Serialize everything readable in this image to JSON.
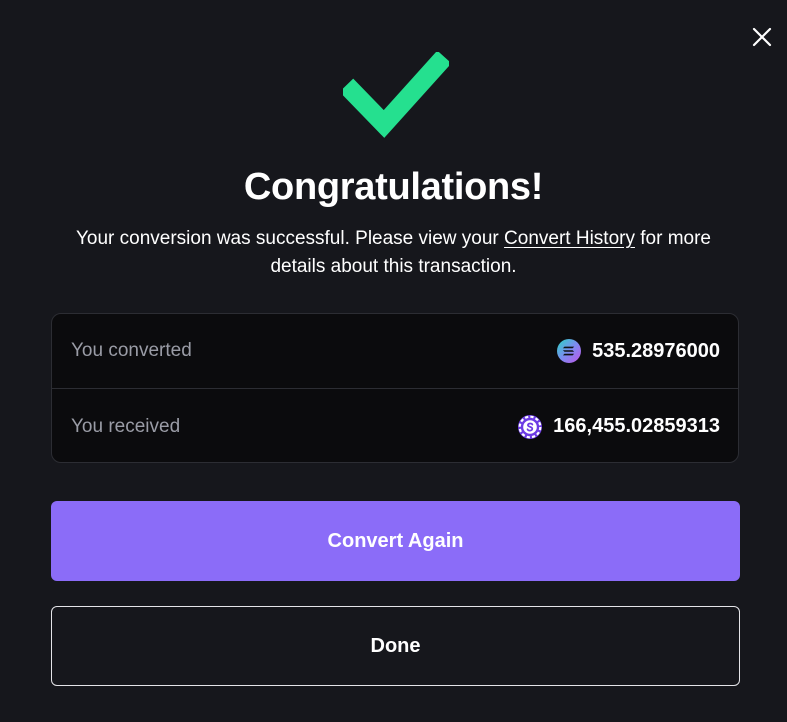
{
  "dialog": {
    "title": "Congratulations!",
    "message_before_link": "Your conversion was successful. Please view your ",
    "link_text": "Convert History",
    "message_after_link": " for more details about this transaction.",
    "close_icon": "close-icon",
    "success_icon": "checkmark-icon"
  },
  "summary": {
    "converted": {
      "label": "You converted",
      "amount": "535.28976000",
      "token_icon": "solana-token-icon"
    },
    "received": {
      "label": "You received",
      "amount": "166,455.02859313",
      "token_icon": "purple-s-token-icon"
    }
  },
  "actions": {
    "primary_label": "Convert Again",
    "secondary_label": "Done"
  },
  "colors": {
    "background": "#16171c",
    "panel": "#0b0b0d",
    "accent": "#8b6cf8",
    "success": "#25e08f",
    "muted_text": "#9a9ca6"
  }
}
